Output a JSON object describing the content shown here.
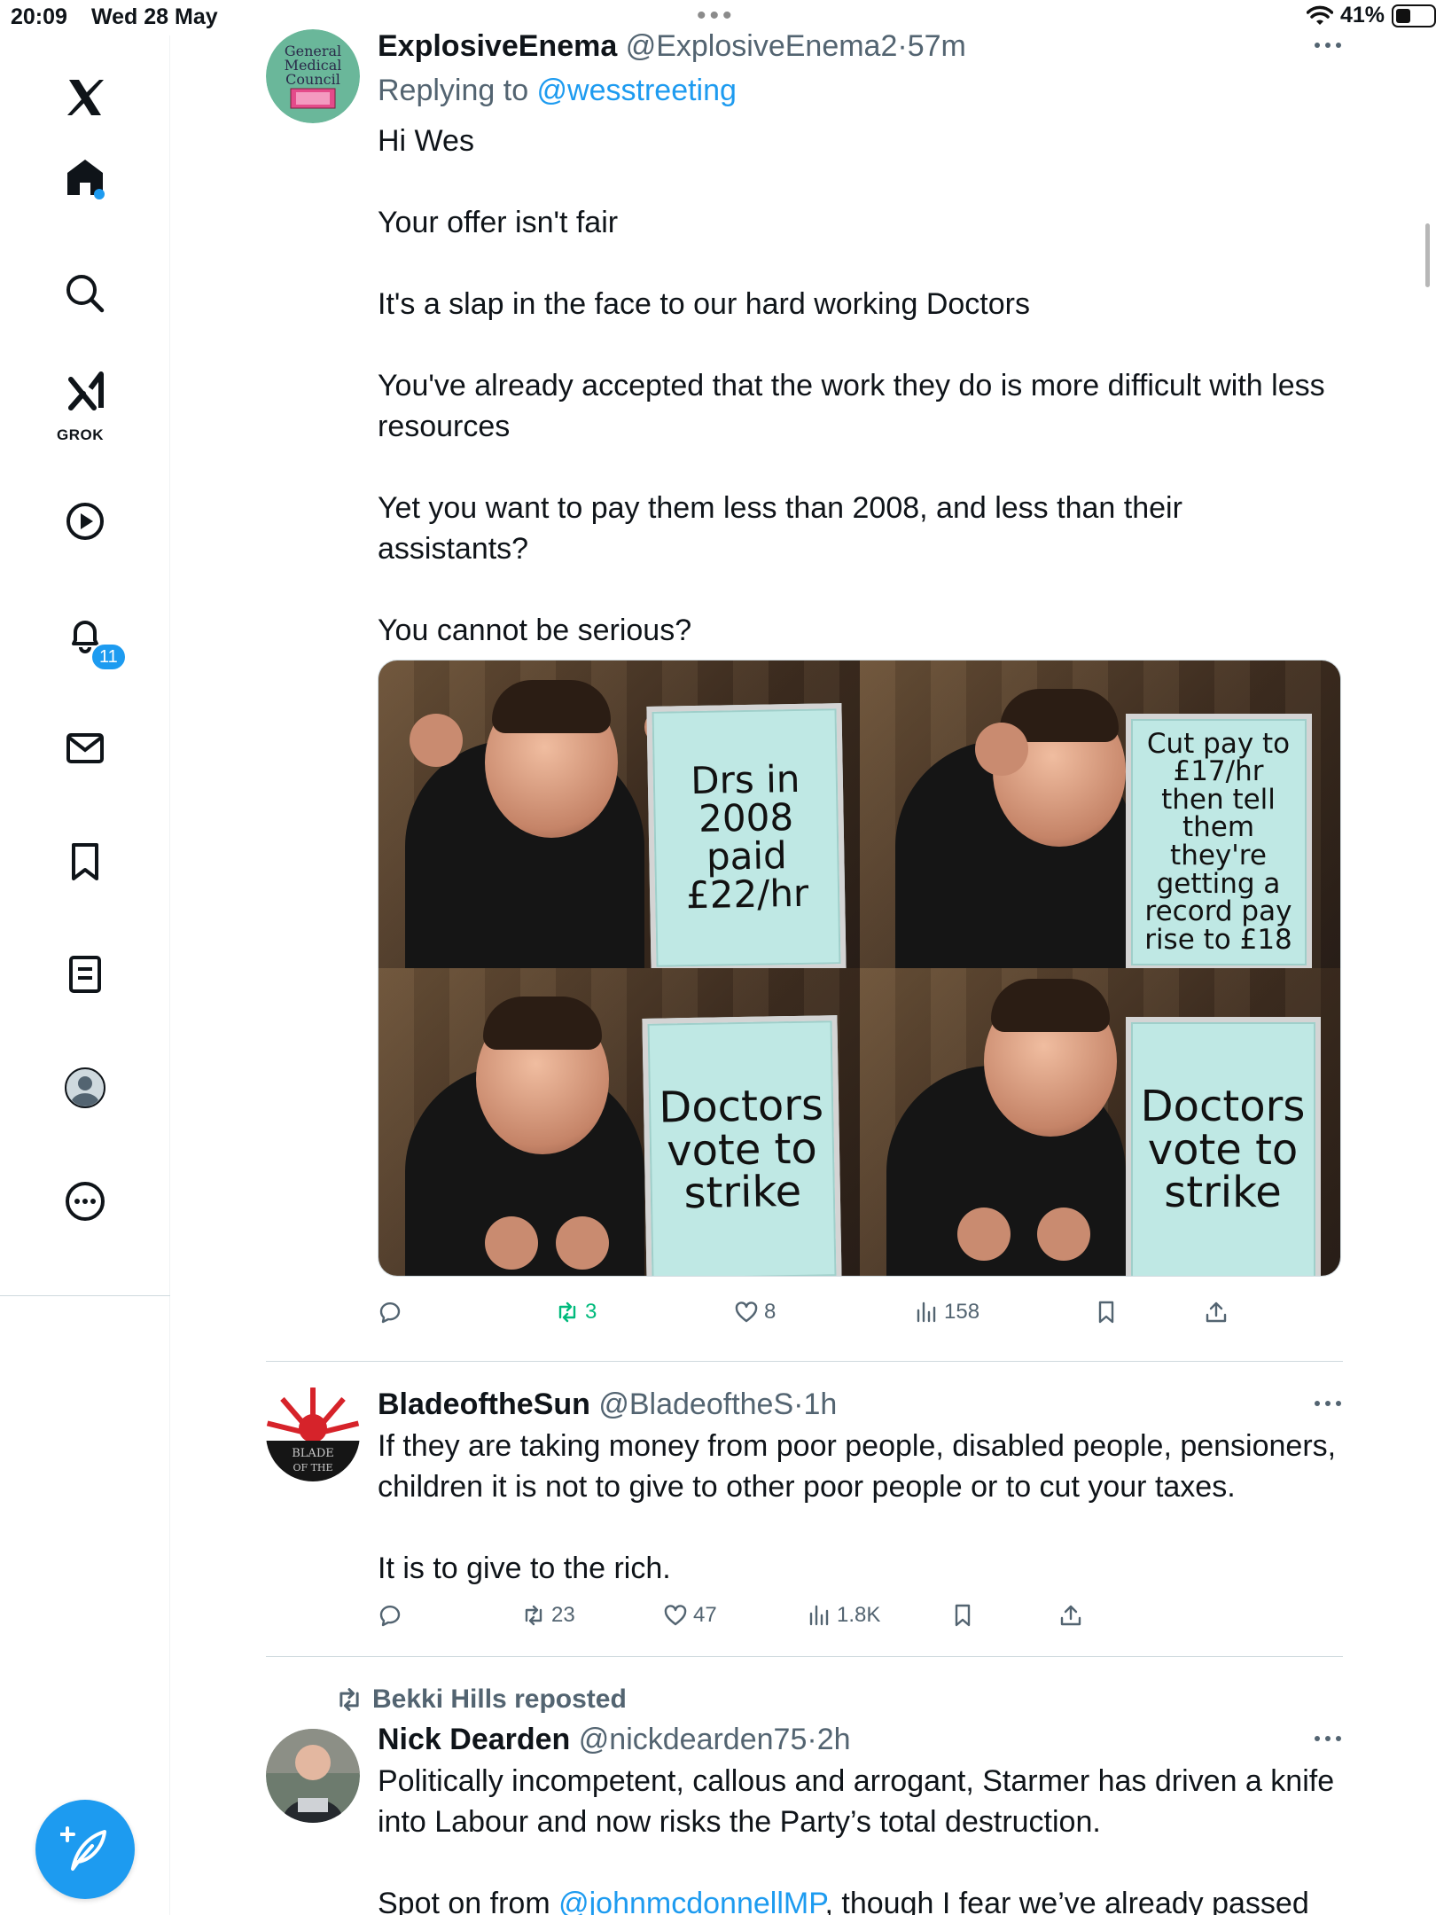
{
  "status_bar": {
    "time": "20:09",
    "date": "Wed 28 May",
    "battery": "41%"
  },
  "sidebar": {
    "grok_label": "GROK",
    "notification_count": "11"
  },
  "tweets": [
    {
      "name": "ExplosiveEnema",
      "handle": "@ExplosiveEnema2",
      "separator": "·",
      "time": "57m",
      "replying_prefix": "Replying to ",
      "replying_to": "@wesstreeting",
      "paragraphs": [
        "Hi Wes",
        "Your offer isn't fair",
        "It's a slap in the face to our hard working Doctors",
        "You've already accepted that the work they do is more difficult with less resources",
        "Yet you want to pay them less than 2008, and less than their assistants?",
        "You cannot be serious?"
      ],
      "meme_boards": [
        "Drs in 2008 paid £22/hr",
        "Cut pay to £17/hr then tell them they're getting a record pay rise to £18",
        "Doctors vote to strike",
        "Doctors vote to strike"
      ],
      "stats": {
        "replies": "",
        "reposts": "3",
        "likes": "8",
        "views": "158"
      }
    },
    {
      "name": "BladeoftheSun",
      "handle": "@BladeoftheS",
      "separator": "·",
      "time": "1h",
      "paragraphs": [
        "If they are taking money from poor people, disabled people, pensioners, children it is not to give to other poor people or to cut your taxes.",
        "It is to give to the rich."
      ],
      "stats": {
        "replies": "",
        "reposts": "23",
        "likes": "47",
        "views": "1.8K"
      }
    },
    {
      "repost_label": "Bekki Hills reposted",
      "name": "Nick Dearden",
      "handle": "@nickdearden75",
      "separator": "·",
      "time": "2h",
      "paragraphs": [
        "Politically incompetent, callous and arrogant, Starmer has driven a knife into Labour and now risks the Party’s total destruction."
      ],
      "partial_line_prefix": "Spot on from ",
      "partial_line_mention": "@johnmcdonnellMP",
      "partial_line_suffix": ", though I fear we’ve already passed"
    }
  ],
  "colors": {
    "accent": "#1d9bf0",
    "secondary_text": "#536471",
    "repost_green": "#00ba7c",
    "divider": "#cfd9de"
  },
  "icons": [
    "x-logo-icon",
    "home-icon",
    "search-icon",
    "grok-icon",
    "video-icon",
    "notifications-icon",
    "messages-icon",
    "bookmarks-icon",
    "lists-icon",
    "profile-icon",
    "more-icon",
    "compose-icon",
    "reply-icon",
    "repost-icon",
    "like-icon",
    "views-icon",
    "bookmark-icon",
    "share-icon"
  ]
}
